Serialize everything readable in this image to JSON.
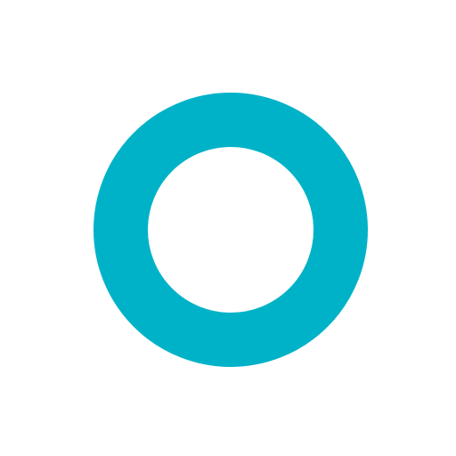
{
  "icon": {
    "name": "ring-icon",
    "color": "#00B2C8",
    "background": "#FFFFFF"
  }
}
